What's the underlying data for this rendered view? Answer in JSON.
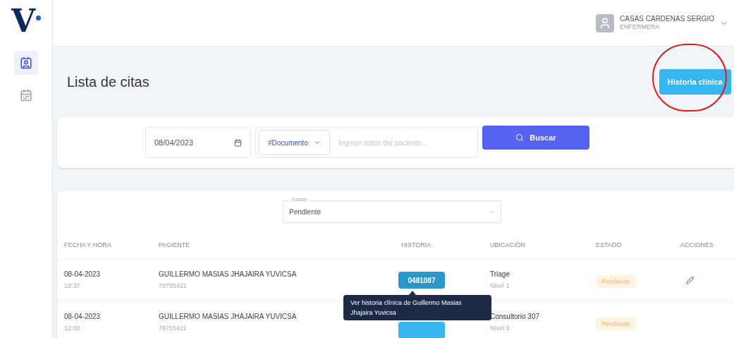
{
  "logo": "V",
  "sidebar": {
    "items": [
      {
        "selected": true
      },
      {
        "selected": false
      }
    ]
  },
  "user": {
    "name": "CASAS CARDENAS SERGIO",
    "role": "ENFERMERA"
  },
  "page_title": "Lista de citas",
  "history_button": {
    "label": "Historia clínica",
    "circled": true
  },
  "search": {
    "date": "08/04/2023",
    "doc_type": "#Documento",
    "placeholder": "Ingrese datos del paciente...",
    "button": "Buscar"
  },
  "filter": {
    "label": "Estado",
    "value": "Pendiente"
  },
  "table": {
    "columns": [
      "FECHA Y HORA",
      "PACIENTE",
      "HISTORIA",
      "UBICACIÓN",
      "ESTADO",
      "ACCIONES"
    ],
    "rows": [
      {
        "date": "08-04-2023",
        "time": "10:37",
        "patient": "GUILLERMO MASIAS JHAJAIRA YUVICSA",
        "doc": "78755421",
        "history": "0481087",
        "location": "Triage",
        "level": "Nivel 1",
        "status": "Pendiente",
        "editable": true,
        "tooltip": "Ver historia clínica de Guillermo Masias Jhajaira Yuvicsa"
      },
      {
        "date": "08-04-2023",
        "time": "12:00",
        "patient": "GUILLERMO MASIAS JHAJAIRA YUVICSA",
        "doc": "78755421",
        "history": "",
        "location": "Consultorio 307",
        "level": "Nivel 3",
        "status": "Pendiente",
        "editable": false
      }
    ]
  }
}
